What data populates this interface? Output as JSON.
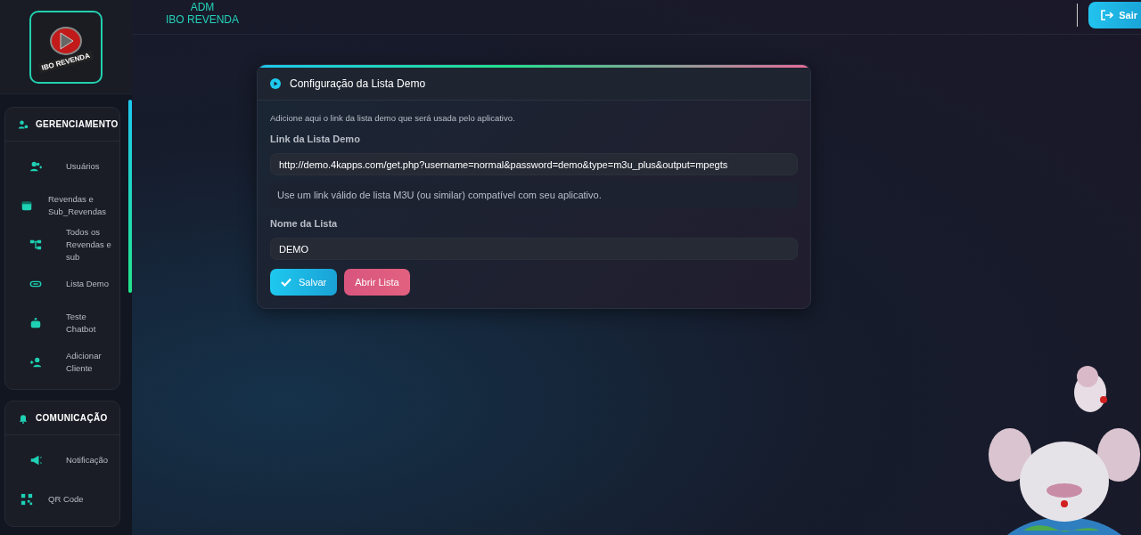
{
  "logo": {
    "text": "IBO REVENDA"
  },
  "header": {
    "role": "ADM",
    "brand": "IBO REVENDA",
    "logout": "Sair"
  },
  "sidebar": {
    "sections": [
      {
        "title": "GERENCIAMENTO",
        "items": [
          {
            "label": "Usuários"
          },
          {
            "label": "Revendas e Sub_Revendas"
          },
          {
            "label": "Todos os Revendas e sub"
          },
          {
            "label": "Lista Demo"
          },
          {
            "label": "Teste Chatbot"
          },
          {
            "label": "Adicionar Cliente"
          }
        ]
      },
      {
        "title": "COMUNICAÇÃO",
        "items": [
          {
            "label": "Notificação"
          },
          {
            "label": "QR Code"
          }
        ]
      }
    ]
  },
  "card": {
    "title": "Configuração da Lista Demo",
    "description": "Adicione aqui o link da lista demo que será usada pelo aplicativo.",
    "fields": [
      {
        "label": "Link da Lista Demo",
        "value": "http://demo.4kapps.com/get.php?username=normal&password=demo&type=m3u_plus&output=mpegts",
        "hint": "Use um link válido de lista M3U (ou similar) compatível com seu aplicativo."
      },
      {
        "label": "Nome da Lista",
        "value": "DEMO"
      }
    ],
    "buttons": [
      {
        "label": "Salvar",
        "kind": "primary"
      },
      {
        "label": "Abrir Lista",
        "kind": "secondary"
      }
    ]
  }
}
